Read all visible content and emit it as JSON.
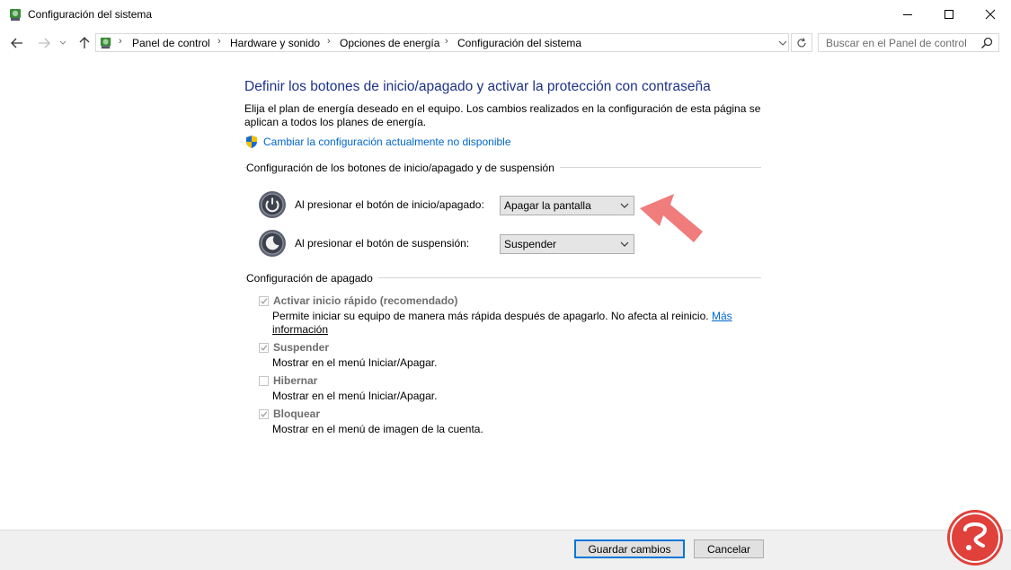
{
  "window": {
    "title": "Configuración del sistema"
  },
  "address": {
    "breadcrumbs": [
      "Panel de control",
      "Hardware y sonido",
      "Opciones de energía",
      "Configuración del sistema"
    ],
    "search_placeholder": "Buscar en el Panel de control"
  },
  "content": {
    "heading": "Definir los botones de inicio/apagado y activar la protección con contraseña",
    "description": "Elija el plan de energía deseado en el equipo. Los cambios realizados en la configuración de esta página se aplican a todos los planes de energía.",
    "change_link": "Cambiar la configuración actualmente no disponible",
    "power_section": {
      "title": "Configuración de los botones de inicio/apagado y de suspensión",
      "rows": [
        {
          "label": "Al presionar el botón de inicio/apagado:",
          "value": "Apagar la pantalla",
          "icon": "power-button-icon"
        },
        {
          "label": "Al presionar el botón de suspensión:",
          "value": "Suspender",
          "icon": "sleep-button-icon"
        }
      ]
    },
    "shutdown_section": {
      "title": "Configuración de apagado",
      "options": [
        {
          "label": "Activar inicio rápido (recomendado)",
          "checked": true,
          "desc": "Permite iniciar su equipo de manera más rápida después de apagarlo. No afecta al reinicio.",
          "more_link_1": "Más",
          "more_link_2": "información"
        },
        {
          "label": "Suspender",
          "checked": true,
          "desc": "Mostrar en el menú Iniciar/Apagar."
        },
        {
          "label": "Hibernar",
          "checked": false,
          "desc": "Mostrar en el menú Iniciar/Apagar."
        },
        {
          "label": "Bloquear",
          "checked": true,
          "desc": "Mostrar en el menú de imagen de la cuenta."
        }
      ]
    }
  },
  "footer": {
    "save_label": "Guardar cambios",
    "cancel_label": "Cancelar"
  },
  "colors": {
    "heading": "#1e3287",
    "link": "#0066cc",
    "annotation_arrow": "#f07c7c",
    "logo_red": "#e0413b"
  }
}
